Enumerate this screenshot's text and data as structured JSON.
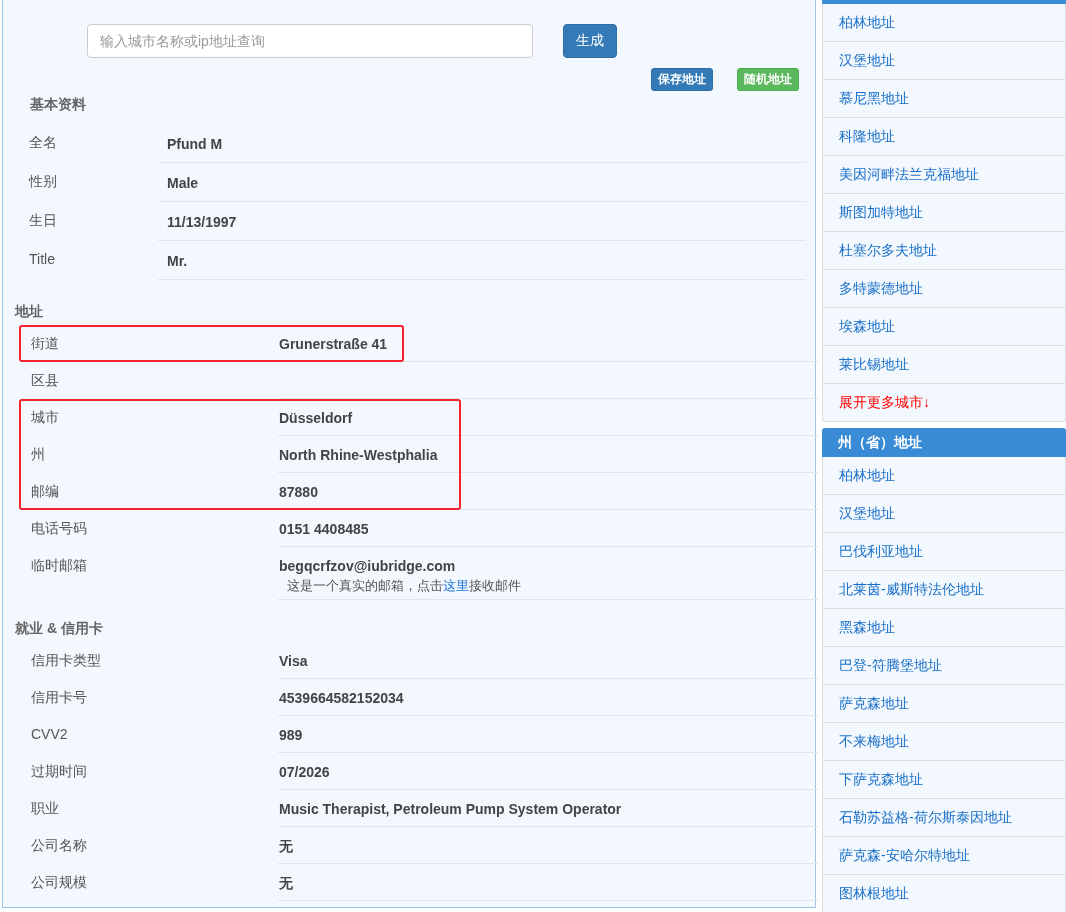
{
  "search": {
    "placeholder": "输入城市名称或ip地址查询",
    "button": "生成"
  },
  "actions": [
    {
      "label": "保存地址",
      "kind": "primary"
    },
    {
      "label": "随机地址",
      "kind": "success"
    }
  ],
  "basic": {
    "title": "基本资料",
    "rows": [
      {
        "label": "全名",
        "value": "Pfund M"
      },
      {
        "label": "性别",
        "value": "Male"
      },
      {
        "label": "生日",
        "value": "11/13/1997"
      },
      {
        "label": "Title",
        "value": "Mr."
      }
    ]
  },
  "address": {
    "title": "地址",
    "groups": [
      {
        "highlighted": true,
        "rows": [
          {
            "label": "街道",
            "value": "Grunerstraße 41"
          }
        ]
      },
      {
        "highlighted": false,
        "rows": [
          {
            "label": "区县"
          }
        ]
      },
      {
        "highlighted": true,
        "rows": [
          {
            "label": "城市",
            "value": "Düsseldorf"
          },
          {
            "label": "州",
            "value": "North Rhine-Westphalia"
          },
          {
            "label": "邮编",
            "value": "87880"
          }
        ]
      },
      {
        "highlighted": false,
        "rows": [
          {
            "label": "电话号码",
            "value": "0151 4408485"
          },
          {
            "label": "临时邮箱",
            "value": "begqcrfzov@iubridge.com",
            "note": {
              "before": "这是一个真实的邮箱，点击",
              "link": "这里",
              "after": "接收邮件"
            }
          }
        ]
      }
    ]
  },
  "employment": {
    "title": "就业 & 信用卡",
    "rows": [
      {
        "label": "信用卡类型",
        "value": "Visa"
      },
      {
        "label": "信用卡号",
        "value": "4539664582152034"
      },
      {
        "label": "CVV2",
        "value": "989"
      },
      {
        "label": "过期时间",
        "value": "07/2026"
      },
      {
        "label": "职业",
        "value": "Music Therapist, Petroleum Pump System Operator"
      },
      {
        "label": "公司名称",
        "value": "无"
      },
      {
        "label": "公司规模",
        "value": "无"
      }
    ]
  },
  "sidebar": {
    "city_links": {
      "items": [
        {
          "label": "柏林地址",
          "kind": "link"
        },
        {
          "label": "汉堡地址",
          "kind": "link"
        },
        {
          "label": "慕尼黑地址",
          "kind": "link"
        },
        {
          "label": "科隆地址",
          "kind": "link"
        },
        {
          "label": "美因河畔法兰克福地址",
          "kind": "link"
        },
        {
          "label": "斯图加特地址",
          "kind": "link"
        },
        {
          "label": "杜塞尔多夫地址",
          "kind": "link"
        },
        {
          "label": "多特蒙德地址",
          "kind": "link"
        },
        {
          "label": "埃森地址",
          "kind": "link"
        },
        {
          "label": "莱比锡地址",
          "kind": "link"
        },
        {
          "label": "展开更多城市↓",
          "kind": "expand"
        }
      ]
    },
    "state_links": {
      "title": "州（省）地址",
      "items": [
        {
          "label": "柏林地址",
          "kind": "link"
        },
        {
          "label": "汉堡地址",
          "kind": "link"
        },
        {
          "label": "巴伐利亚地址",
          "kind": "link"
        },
        {
          "label": "北莱茵-威斯特法伦地址",
          "kind": "link"
        },
        {
          "label": "黑森地址",
          "kind": "link"
        },
        {
          "label": "巴登-符腾堡地址",
          "kind": "link"
        },
        {
          "label": "萨克森地址",
          "kind": "link"
        },
        {
          "label": "不来梅地址",
          "kind": "link"
        },
        {
          "label": "下萨克森地址",
          "kind": "link"
        },
        {
          "label": "石勒苏益格-荷尔斯泰因地址",
          "kind": "link"
        },
        {
          "label": "萨克森-安哈尔特地址",
          "kind": "link"
        },
        {
          "label": "图林根地址",
          "kind": "link"
        }
      ]
    }
  }
}
